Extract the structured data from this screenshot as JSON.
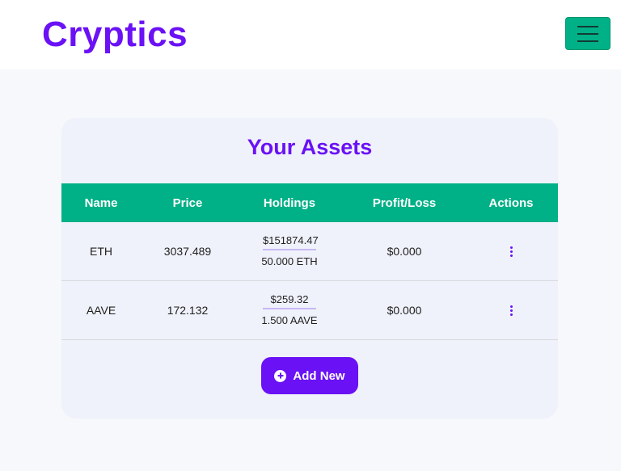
{
  "navbar": {
    "brand": "Cryptics",
    "menu_icon": "hamburger-menu-icon"
  },
  "assets": {
    "title": "Your Assets",
    "columns": [
      "Name",
      "Price",
      "Holdings",
      "Profit/Loss",
      "Actions"
    ],
    "rows": [
      {
        "name": "ETH",
        "price": "3037.489",
        "holdings_usd": "$151874.47",
        "holdings_amount": "50.000 ETH",
        "profit_loss": "$0.000",
        "actions_icon": "kebab-menu-icon"
      },
      {
        "name": "AAVE",
        "price": "172.132",
        "holdings_usd": "$259.32",
        "holdings_amount": "1.500 AAVE",
        "profit_loss": "$0.000",
        "actions_icon": "kebab-menu-icon"
      }
    ],
    "add_button": {
      "label": "Add New",
      "icon": "plus-circle-icon"
    }
  },
  "colors": {
    "brand": "#6a11f5",
    "accent_green": "#00b086",
    "card_bg": "#eff2fa",
    "page_bg": "#f7f8fc"
  }
}
